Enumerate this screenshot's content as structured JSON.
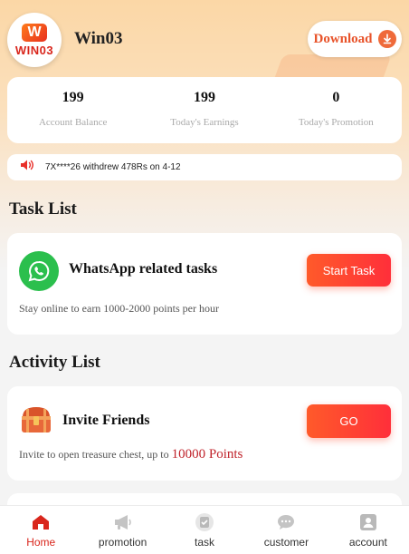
{
  "header": {
    "logo": {
      "mark": "W",
      "text": "WIN03"
    },
    "app_name": "Win03",
    "download_label": "Download"
  },
  "stats": [
    {
      "value": "199",
      "label": "Account Balance"
    },
    {
      "value": "199",
      "label": "Today's Earnings"
    },
    {
      "value": "0",
      "label": "Today's Promotion"
    }
  ],
  "notice": {
    "text": "7X****26 withdrew 478Rs on 4-12"
  },
  "task_section": {
    "title": "Task List",
    "tasks": [
      {
        "title": "WhatsApp related tasks",
        "description": "Stay online to earn 1000-2000 points per hour",
        "button_label": "Start Task",
        "icon": "whatsapp-icon"
      }
    ]
  },
  "activity_section": {
    "title": "Activity List",
    "activities": [
      {
        "title": "Invite Friends",
        "description": "Invite to open treasure chest, up to",
        "highlight": "10000 Points",
        "button_label": "GO",
        "icon": "treasure-chest-icon"
      }
    ]
  },
  "tabbar": {
    "tabs": [
      {
        "label": "Home",
        "icon": "home-icon",
        "active": true
      },
      {
        "label": "promotion",
        "icon": "megaphone-icon",
        "active": false
      },
      {
        "label": "task",
        "icon": "task-icon",
        "active": false
      },
      {
        "label": "customer",
        "icon": "chat-icon",
        "active": false
      },
      {
        "label": "account",
        "icon": "user-icon",
        "active": false
      }
    ]
  },
  "colors": {
    "accent": "#ff3f32",
    "whatsapp": "#2bbf4d",
    "active_tab": "#d9261c",
    "points_highlight": "#c0232b"
  }
}
